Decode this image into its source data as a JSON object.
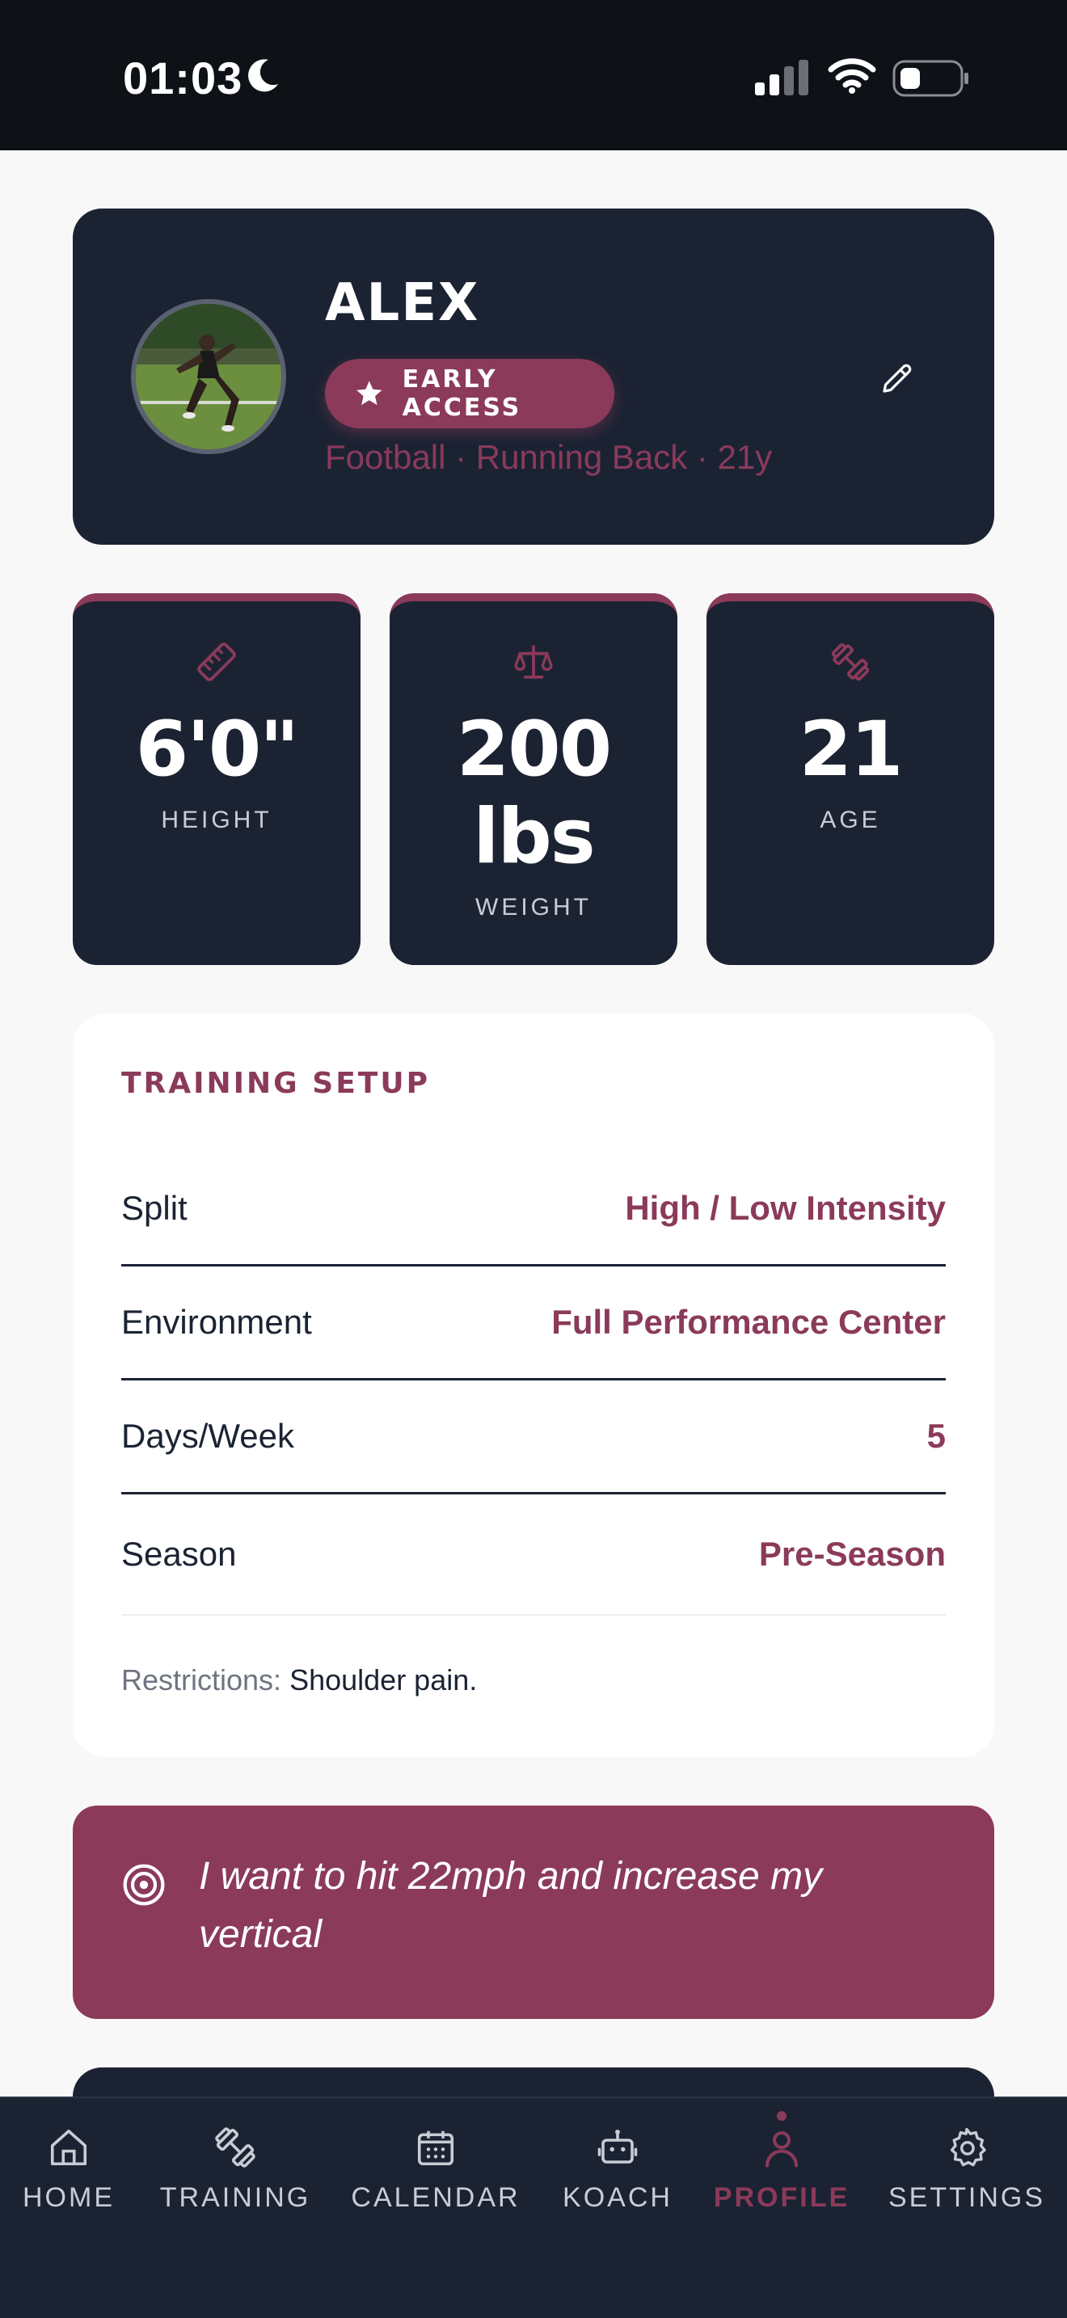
{
  "status_bar": {
    "time": "01:03"
  },
  "profile": {
    "name": "ALEX",
    "badge": "EARLY ACCESS",
    "subtitle": "Football · Running Back · 21y"
  },
  "stats": [
    {
      "icon": "ruler-icon",
      "value": "6'0\"",
      "label": "HEIGHT"
    },
    {
      "icon": "scale-icon",
      "value_line1": "200",
      "value_line2": "lbs",
      "label": "WEIGHT"
    },
    {
      "icon": "dumbbell-icon",
      "value": "21",
      "label": "AGE"
    }
  ],
  "training_setup": {
    "title": "TRAINING SETUP",
    "rows": [
      {
        "label": "Split",
        "value": "High / Low Intensity"
      },
      {
        "label": "Environment",
        "value": "Full Performance Center"
      },
      {
        "label": "Days/Week",
        "value": "5"
      },
      {
        "label": "Season",
        "value": "Pre-Season"
      }
    ],
    "restrictions_label": "Restrictions:",
    "restrictions_value": "Shoulder pain."
  },
  "goal": {
    "text": "I want to hit 22mph and increase my vertical"
  },
  "nav": {
    "items": [
      {
        "label": "HOME",
        "icon": "home-icon",
        "active": false
      },
      {
        "label": "TRAINING",
        "icon": "dumbbell-icon",
        "active": false
      },
      {
        "label": "CALENDAR",
        "icon": "calendar-icon",
        "active": false
      },
      {
        "label": "KOACH",
        "icon": "robot-icon",
        "active": false
      },
      {
        "label": "PROFILE",
        "icon": "person-icon",
        "active": true
      },
      {
        "label": "SETTINGS",
        "icon": "gear-icon",
        "active": false
      }
    ]
  },
  "colors": {
    "accent": "#8b3a5a",
    "navy": "#1b2333",
    "background": "#f8f8f8",
    "status_bar": "#0e1217"
  }
}
